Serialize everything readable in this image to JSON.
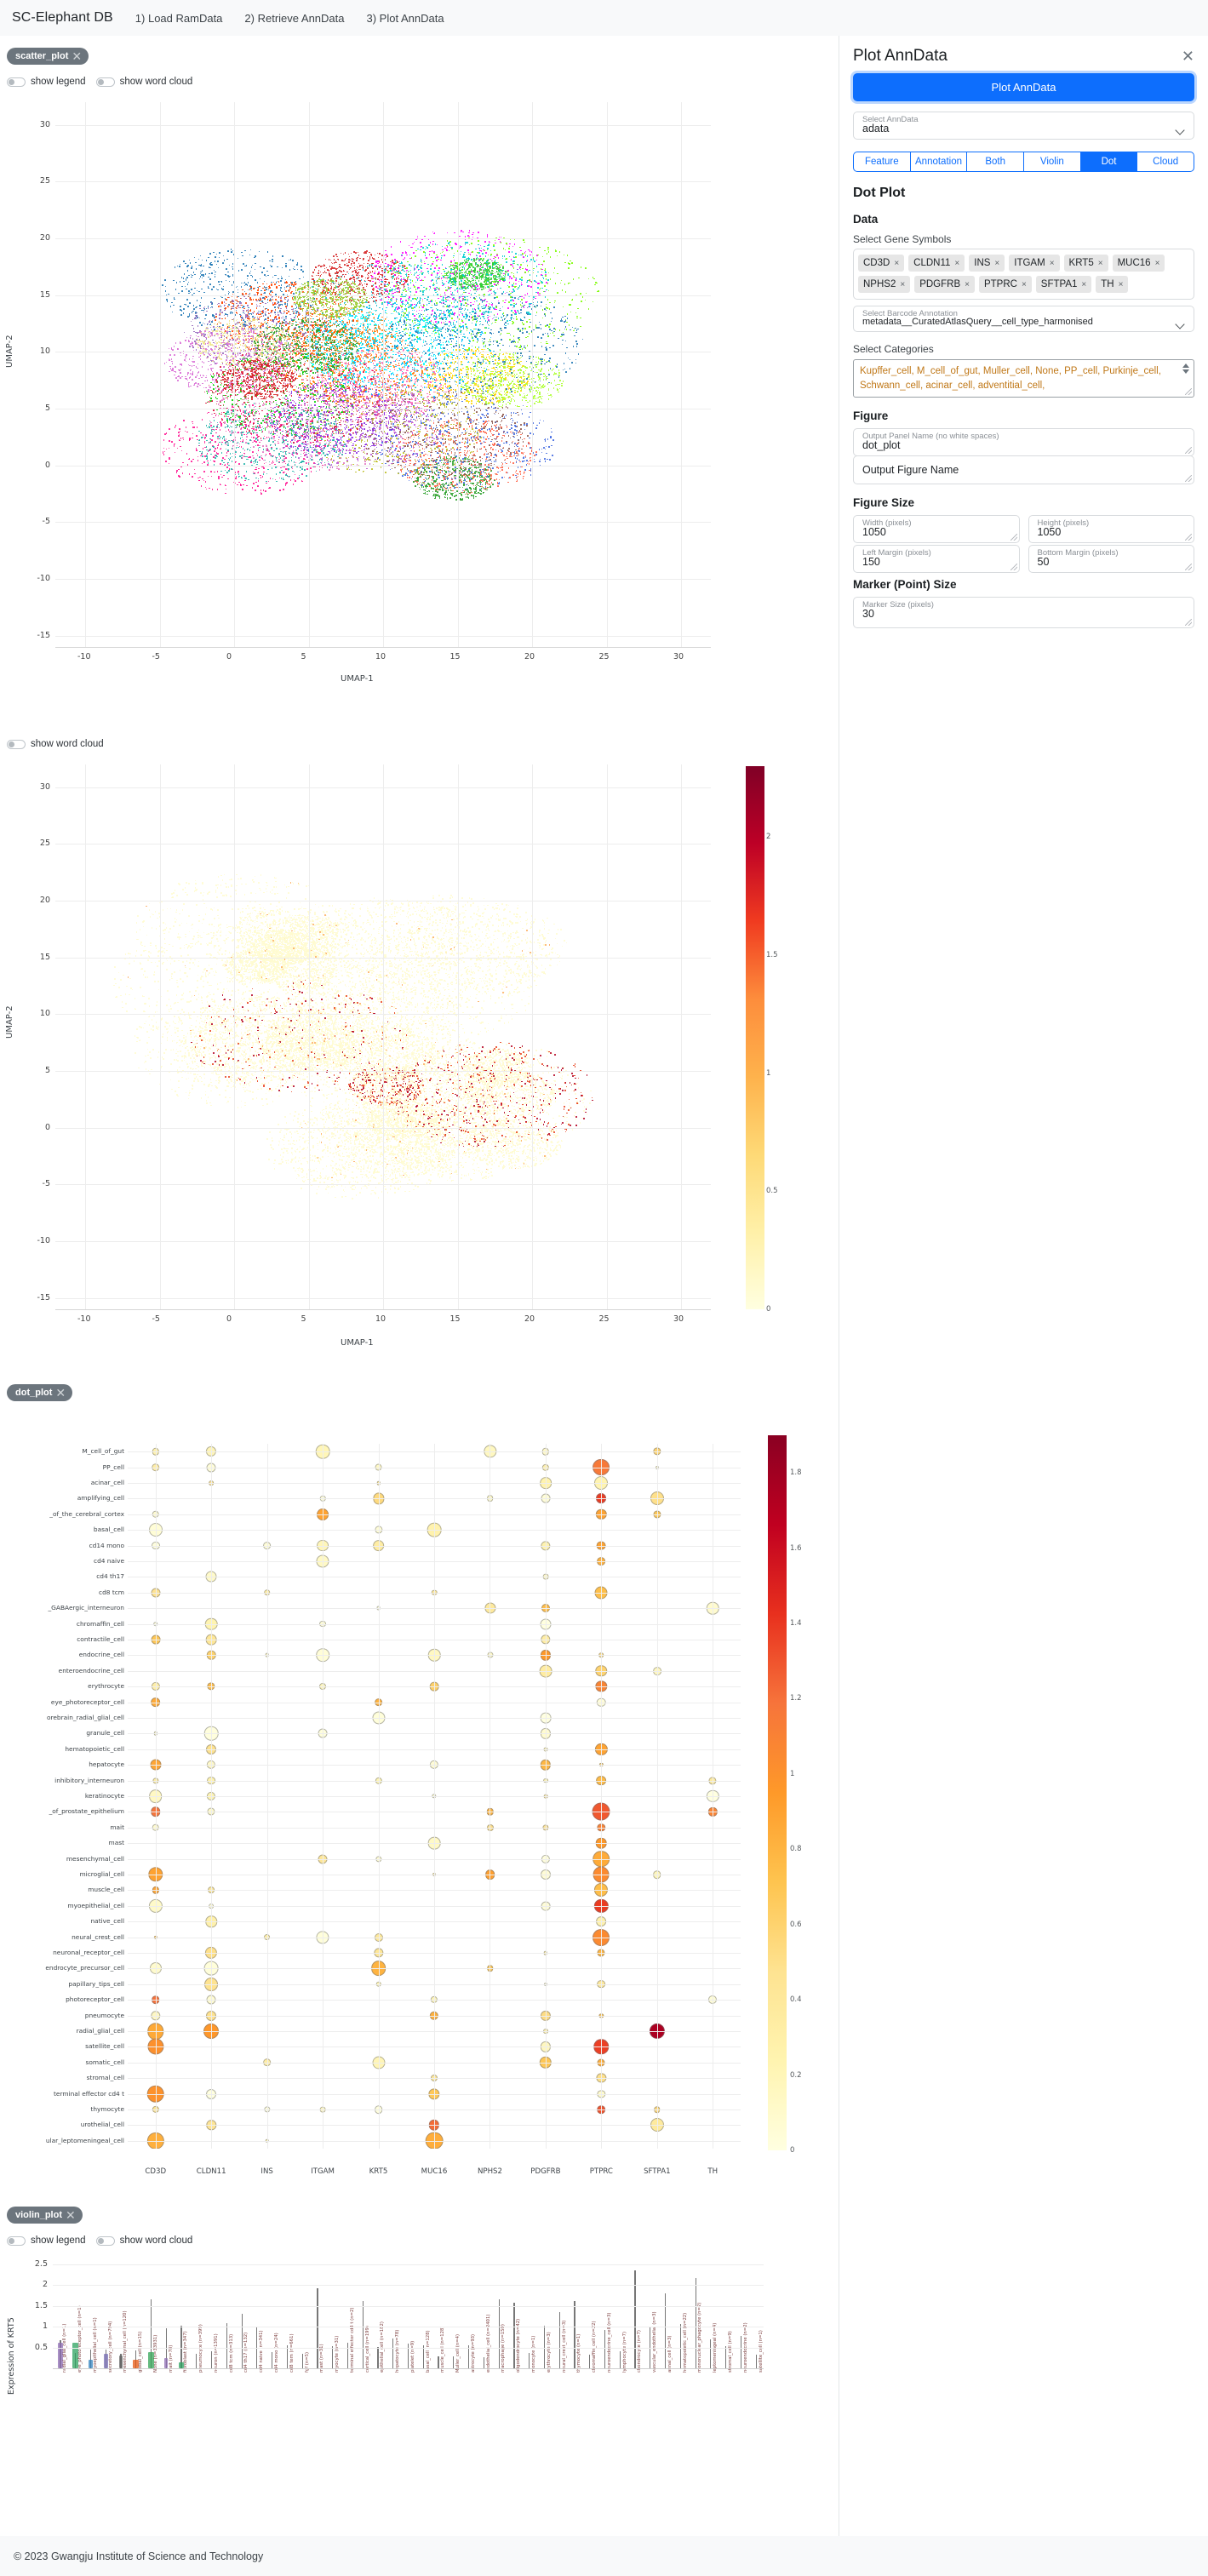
{
  "navbar": {
    "brand": "SC-Elephant DB",
    "links": [
      "1) Load RamData",
      "2) Retrieve AnnData",
      "3) Plot AnnData"
    ]
  },
  "panels": {
    "scatter": {
      "chip": "scatter_plot",
      "close": "✕",
      "toggles": [
        {
          "label": "show legend",
          "on": false
        },
        {
          "label": "show word cloud",
          "on": false
        }
      ]
    },
    "feature_scatter": {
      "toggles": [
        {
          "label": "show word cloud",
          "on": false
        }
      ]
    },
    "dot": {
      "chip": "dot_plot",
      "close": "✕"
    },
    "violin": {
      "chip": "violin_plot",
      "close": "✕",
      "toggles": [
        {
          "label": "show legend",
          "on": false
        },
        {
          "label": "show word cloud",
          "on": false
        }
      ]
    }
  },
  "sidebar": {
    "title": "Plot AnnData",
    "close_icon": "✕",
    "plot_button": "Plot AnnData",
    "select_anndata": {
      "label": "Select AnnData",
      "value": "adata"
    },
    "mode_tabs": [
      {
        "label": "Feature",
        "active": false
      },
      {
        "label": "Annotation",
        "active": false
      },
      {
        "label": "Both",
        "active": false
      },
      {
        "label": "Violin",
        "active": false
      },
      {
        "label": "Dot",
        "active": true
      },
      {
        "label": "Cloud",
        "active": false
      }
    ],
    "section_title": "Dot Plot",
    "data_heading": "Data",
    "gene_symbols_label": "Select Gene Symbols",
    "gene_symbols": [
      "CD3D",
      "CLDN11",
      "INS",
      "ITGAM",
      "KRT5",
      "MUC16",
      "NPHS2",
      "PDGFRB",
      "PTPRC",
      "SFTPA1",
      "TH"
    ],
    "barcode_annotation": {
      "label": "Select Barcode Annotation",
      "value": "metadata__CuratedAtlasQuery__cell_type_harmonised"
    },
    "categories_label": "Select Categories",
    "categories_value": "Kupffer_cell, M_cell_of_gut, Muller_cell, None, PP_cell, Purkinje_cell, Schwann_cell, acinar_cell, adventitial_cell,",
    "figure_heading": "Figure",
    "output_panel_name": {
      "label": "Output Panel Name (no white spaces)",
      "value": "dot_plot"
    },
    "output_figure_name": {
      "label": "",
      "value": "Output Figure Name"
    },
    "figure_size_heading": "Figure Size",
    "width": {
      "label": "Width (pixels)",
      "value": "1050"
    },
    "height": {
      "label": "Height (pixels)",
      "value": "1050"
    },
    "left_margin": {
      "label": "Left Margin (pixels)",
      "value": "150"
    },
    "bottom_margin": {
      "label": "Bottom Margin (pixels)",
      "value": "50"
    },
    "marker_size_heading": "Marker (Point) Size",
    "marker_size": {
      "label": "Marker Size (pixels)",
      "value": "30"
    }
  },
  "footer": {
    "text": "© 2023 Gwangju Institute of Science and Technology"
  },
  "chart_data": [
    {
      "id": "umap_categorical",
      "type": "scatter",
      "title": "",
      "xlabel": "UMAP-1",
      "ylabel": "UMAP-2",
      "xlim": [
        -12,
        32
      ],
      "ylim": [
        -16,
        32
      ],
      "xticks": [
        -10,
        -5,
        0,
        5,
        10,
        15,
        20,
        25,
        30
      ],
      "yticks": [
        -15,
        -10,
        -5,
        0,
        5,
        10,
        15,
        20,
        25,
        30
      ],
      "grid": true,
      "legend": false,
      "colormap": "categorical (cell types)",
      "n_points_approx": 25000
    },
    {
      "id": "umap_feature",
      "type": "scatter",
      "title": "",
      "xlabel": "UMAP-1",
      "ylabel": "UMAP-2",
      "xlim": [
        -12,
        32
      ],
      "ylim": [
        -16,
        32
      ],
      "xticks": [
        -10,
        -5,
        0,
        5,
        10,
        15,
        20,
        25,
        30
      ],
      "yticks": [
        -15,
        -10,
        -5,
        0,
        5,
        10,
        15,
        20,
        25,
        30
      ],
      "grid": true,
      "colorbar": {
        "ticks": [
          "0",
          "0.5",
          "1",
          "1.5",
          "2"
        ],
        "min": 0,
        "max": 2.3,
        "colormap": "YlOrRd"
      }
    },
    {
      "id": "dot_plot",
      "type": "heatmap",
      "title": "",
      "xlabel": "",
      "ylabel": "",
      "categories": [
        "CD3D",
        "CLDN11",
        "INS",
        "ITGAM",
        "KRT5",
        "MUC16",
        "NPHS2",
        "PDGFRB",
        "PTPRC",
        "SFTPA1",
        "TH"
      ],
      "rows": [
        "M_cell_of_gut",
        "PP_cell",
        "acinar_cell",
        "amplifying_cell",
        "_of_the_cerebral_cortex",
        "basal_cell",
        "cd14 mono",
        "cd4 naive",
        "cd4 th17",
        "cd8 tcm",
        "_GABAergic_interneuron",
        "chromaffin_cell",
        "contractile_cell",
        "endocrine_cell",
        "enteroendocrine_cell",
        "erythrocyte",
        "eye_photoreceptor_cell",
        "orebrain_radial_glial_cell",
        "granule_cell",
        "hematopoietic_cell",
        "hepatocyte",
        "inhibitory_interneuron",
        "keratinocyte",
        "_of_prostate_epithelium",
        "mait",
        "mast",
        "mesenchymal_cell",
        "microglial_cell",
        "muscle_cell",
        "myoepithelial_cell",
        "native_cell",
        "neural_crest_cell",
        "neuronal_receptor_cell",
        "endrocyte_precursor_cell",
        "papillary_tips_cell",
        "photoreceptor_cell",
        "pneumocyte",
        "radial_glial_cell",
        "satellite_cell",
        "somatic_cell",
        "stromal_cell",
        "terminal effector cd4 t",
        "thymocyte",
        "urothelial_cell",
        "ular_leptomeningeal_cell"
      ],
      "colorbar": {
        "ticks": [
          "0",
          "0.2",
          "0.4",
          "0.6",
          "0.8",
          "1",
          "1.2",
          "1.4",
          "1.6",
          "1.8"
        ],
        "min": 0,
        "max": 1.9,
        "colormap": "YlOrRd"
      },
      "encoding": "dot size = fraction of cells expressing; dot color = mean expression"
    },
    {
      "id": "violin_plot",
      "type": "bar",
      "title": "",
      "ylabel": "Expression of KRT5",
      "yticks": [
        "0.5",
        "1",
        "1.5",
        "2",
        "2.5"
      ],
      "ylim": [
        0,
        2.7
      ],
      "grid": true,
      "xlabel": "",
      "categories": [
        "radial_glial_cell (n=1)",
        "eye_photoreceptor_cell (n=1)",
        "myoepithelial_cell (n=1)",
        "secretory_cell (n=794)",
        "mesenchymal_cell (n=120)",
        "global_cell (n=15)",
        "None (n=33931)",
        "mait (n=78)",
        "fibroblast (n=347)",
        "pneumocyte (n=399)",
        "neuron (n=1391)",
        "cd8 tcm (n=313)",
        "cd4 th17 (n=132)",
        "cd4 naive (n=341)",
        "cd4 mono (n=24)",
        "cd8 tem (n=661)",
        "fgf (n=5)",
        "mast (n=31)",
        "myocyte (n=31)",
        "terminal effector cd4 t (n=2)",
        "cortical_cell (n=199)",
        "epithelial_cell (n=182)",
        "hepatocyte (n=78)",
        "platelet (n=9)",
        "basal_cell (n=128)",
        "muscle_cell (n=128)",
        "Muller_cell (n=4)",
        "astrocyte (n=93)",
        "endothelial_cell (n=2401)",
        "macrophage (n=150)",
        "oligodendrocyte (n=42)",
        "monocyte (n=1)",
        "erythrocyte (n=3)",
        "neural_crest_cell (n=3)",
        "thymocyte (n=1)",
        "chromaffin_cell (n=22)",
        "neuroendocrine_cell (n=3)",
        "lymphocyte (n=7)",
        "chondrocyte (n=7)",
        "vascular_endothelial (n=3)",
        "annal_cell (n=3)",
        "hematopoietic_cell (n=22)",
        "mononuclear_phagocyte (n=2)",
        "leptomeningeal (n=4)",
        "stromal_cell (n=9)",
        "neuroendocrine (n=2)",
        "satellite_cell (n=1)"
      ]
    }
  ]
}
